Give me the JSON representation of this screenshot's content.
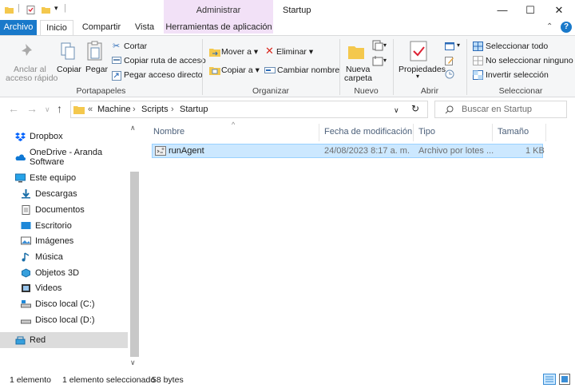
{
  "window": {
    "title": "Startup",
    "context_tab": "Administrar",
    "minimize": "—",
    "maximize": "☐",
    "close": "✕"
  },
  "ribbon_tabs": [
    "Archivo",
    "Inicio",
    "Compartir",
    "Vista",
    "Herramientas de aplicación"
  ],
  "ribbon": {
    "portapapeles": {
      "pin_label_1": "Anclar al",
      "pin_label_2": "acceso rápido",
      "copy": "Copiar",
      "paste": "Pegar",
      "cut": "Cortar",
      "copy_path": "Copiar ruta de acceso",
      "paste_shortcut": "Pegar acceso directo",
      "group": "Portapapeles"
    },
    "organizar": {
      "move_to": "Mover a",
      "copy_to": "Copiar a",
      "delete": "Eliminar",
      "rename": "Cambiar nombre",
      "group": "Organizar"
    },
    "nuevo": {
      "new_folder_1": "Nueva",
      "new_folder_2": "carpeta",
      "group": "Nuevo"
    },
    "abrir": {
      "properties": "Propiedades",
      "group": "Abrir"
    },
    "seleccionar": {
      "select_all": "Seleccionar todo",
      "select_none": "No seleccionar ninguno",
      "invert": "Invertir selección",
      "group": "Seleccionar"
    }
  },
  "address": {
    "overflow": "«",
    "crumbs": [
      "Machine",
      "Scripts",
      "Startup"
    ],
    "search_placeholder": "Buscar en Startup"
  },
  "nav": {
    "items": [
      {
        "label": "Dropbox",
        "icon": "dropbox-icon"
      },
      {
        "label": "OneDrive - Aranda Software",
        "icon": "onedrive-icon"
      },
      {
        "label": "Este equipo",
        "icon": "computer-icon"
      },
      {
        "label": "Descargas",
        "icon": "download-icon"
      },
      {
        "label": "Documentos",
        "icon": "document-icon"
      },
      {
        "label": "Escritorio",
        "icon": "desktop-icon"
      },
      {
        "label": "Imágenes",
        "icon": "pictures-icon"
      },
      {
        "label": "Música",
        "icon": "music-icon"
      },
      {
        "label": "Objetos 3D",
        "icon": "objects3d-icon"
      },
      {
        "label": "Videos",
        "icon": "video-icon"
      },
      {
        "label": "Disco local (C:)",
        "icon": "drive-c-icon"
      },
      {
        "label": "Disco local (D:)",
        "icon": "drive-d-icon"
      },
      {
        "label": "Red",
        "icon": "network-icon"
      }
    ]
  },
  "columns": [
    "Nombre",
    "Fecha de modificación",
    "Tipo",
    "Tamaño"
  ],
  "files": [
    {
      "name": "runAgent",
      "modified": "24/08/2023 8:17 a. m.",
      "type": "Archivo por lotes ...",
      "size": "1 KB"
    }
  ],
  "status": {
    "count": "1 elemento",
    "selected": "1 elemento seleccionado",
    "size": "58 bytes"
  },
  "colors": {
    "accent": "#1979ca",
    "context_tab": "#f2e1f7",
    "selection": "#cce8ff"
  }
}
